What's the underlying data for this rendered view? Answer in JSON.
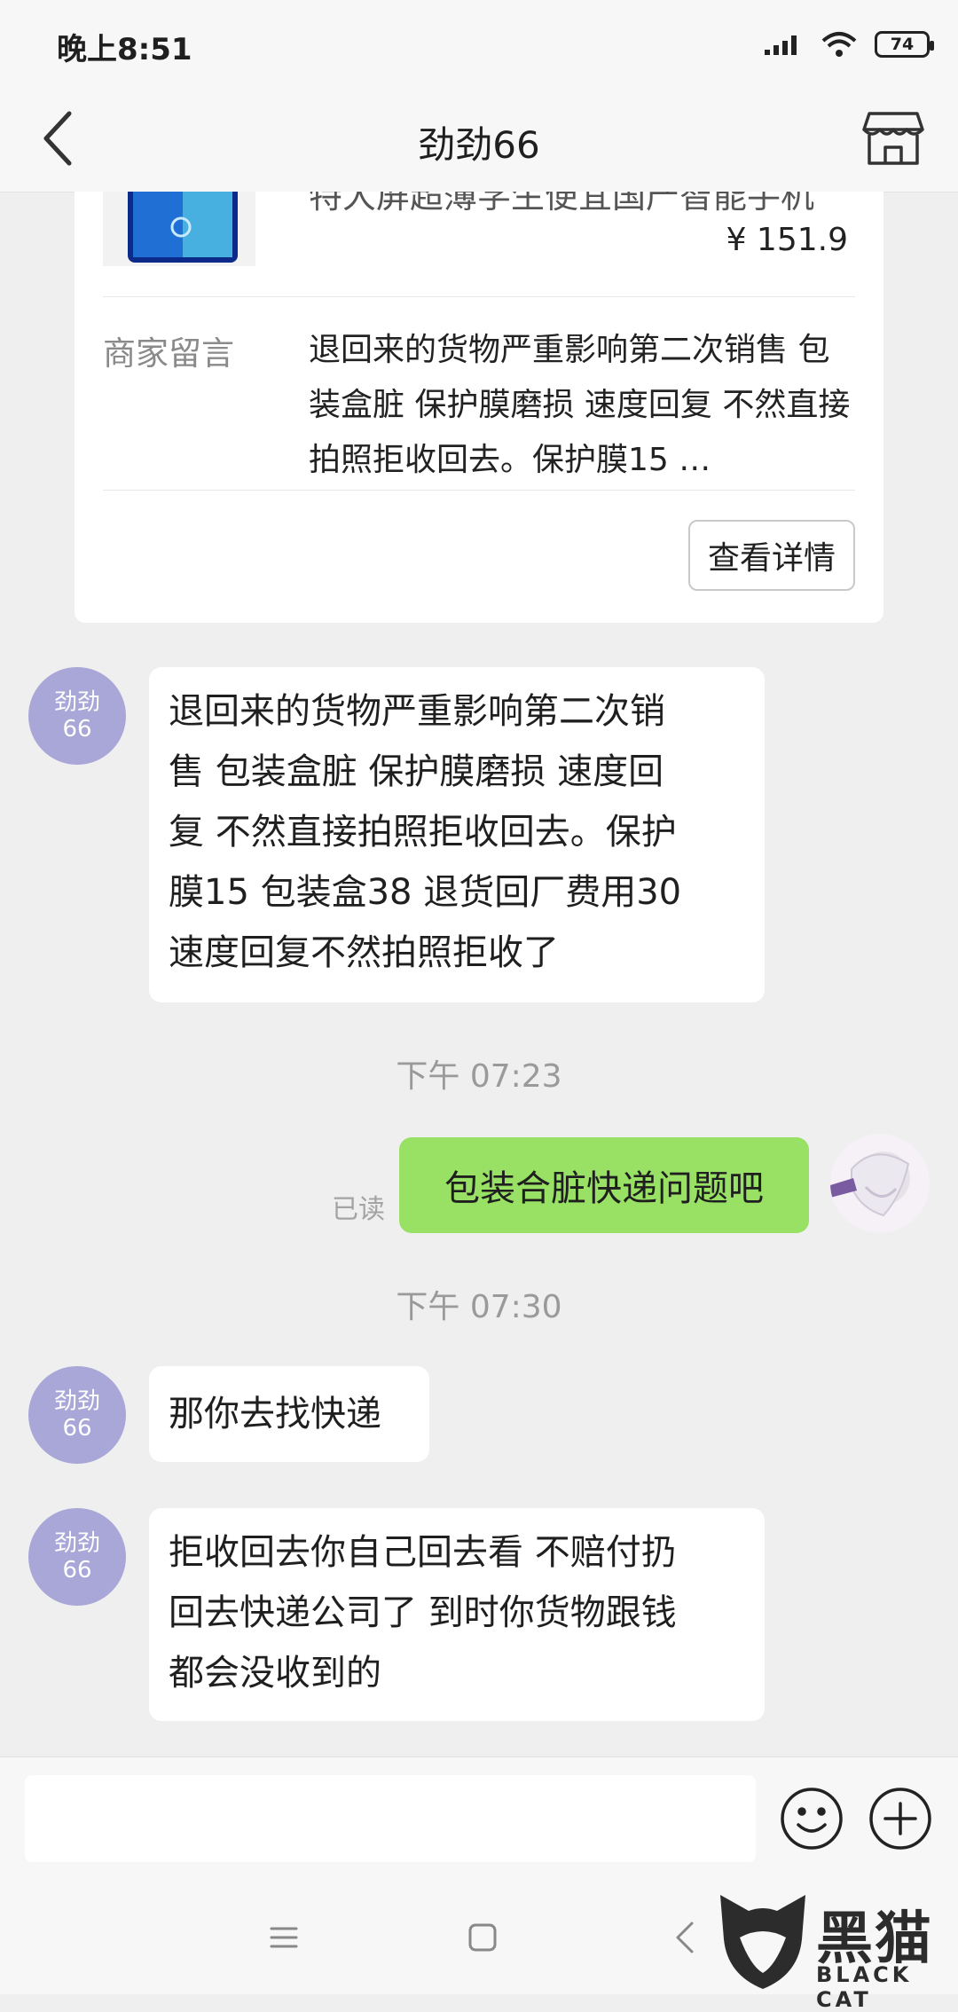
{
  "status_bar": {
    "time": "晚上8:51",
    "battery": "74"
  },
  "header": {
    "title": "劲劲66"
  },
  "product": {
    "name": "特大屏超薄学生便宜国产智能手机",
    "price": "¥ 151.9",
    "message_label": "商家留言",
    "message_text": "退回来的货物严重影响第二次销售 包装盒脏 保护膜磨损 速度回复 不然直接拍照拒收回去。保护膜15 …",
    "details_button": "查看详情"
  },
  "chat": {
    "contact_avatar_text_line1": "劲劲",
    "contact_avatar_text_line2": "66",
    "messages": [
      {
        "lines": [
          "退回来的货物严重影响第二次销",
          "售 包装盒脏 保护膜磨损 速度回",
          "复 不然直接拍照拒收回去。保护",
          "膜15 包装盒38 退货回厂费用30",
          "速度回复不然拍照拒收了"
        ]
      },
      {
        "timestamp": "下午 07:23"
      },
      {
        "text": "包装合脏快递问题吧",
        "status": "已读"
      },
      {
        "timestamp": "下午 07:30"
      },
      {
        "lines": [
          "那你去找快递"
        ]
      },
      {
        "lines": [
          "拒收回去你自己回去看 不赔付扔",
          "回去快递公司了 到时你货物跟钱",
          "都会没收到的"
        ]
      }
    ]
  },
  "watermark": {
    "text": "黑猫",
    "sub": "BLACK CAT"
  },
  "colors": {
    "sent_bubble": "#98e165",
    "avatar": "#a9a6d8",
    "background": "#efeff0"
  }
}
